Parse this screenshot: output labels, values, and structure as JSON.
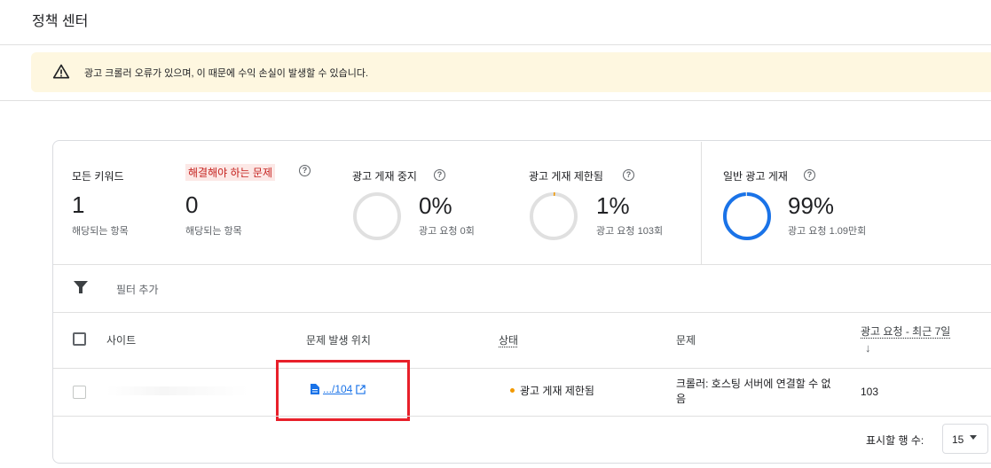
{
  "page": {
    "title": "정책 센터"
  },
  "banner": {
    "message": "광고 크롤러 오류가 있으며, 이 때문에 수익 손실이 발생할 수 있습니다."
  },
  "stats": {
    "all_keywords": {
      "label": "모든 키워드",
      "value": "1",
      "sub": "해당되는 항목"
    },
    "must_fix": {
      "label": "해결해야 하는 문제",
      "help": "?",
      "value": "0",
      "sub": "해당되는 항목"
    },
    "ads_disabled": {
      "label": "광고 게재 중지",
      "help": "?",
      "percent": "0%",
      "sub": "광고 요청 0회",
      "ring_fraction": 0.0
    },
    "ads_restricted": {
      "label": "광고 게재 제한됨",
      "help": "?",
      "percent": "1%",
      "sub": "광고 요청 103회",
      "ring_fraction": 0.01
    },
    "ads_normal": {
      "label": "일반 광고 게재",
      "help": "?",
      "percent": "99%",
      "sub": "광고 요청 1.09만회",
      "ring_fraction": 0.99
    }
  },
  "filter": {
    "label": "필터 추가"
  },
  "table": {
    "headers": {
      "site": "사이트",
      "location": "문제 발생 위치",
      "status": "상태",
      "problem": "문제",
      "requests": "광고 요청 - 최근 7일",
      "sort_arrow": "↓"
    },
    "rows": [
      {
        "site": "",
        "location": ".../104",
        "status": "광고 게재 제한됨",
        "problem": "크롤러: 호스팅 서버에 연결할 수 없음",
        "requests": "103"
      }
    ]
  },
  "pagination": {
    "rows_label": "표시할 행 수:",
    "rows_value": "15"
  },
  "colors": {
    "accent": "#1a73e8",
    "warning_bg": "#fef7e0",
    "highlight_bg": "#fce8e6",
    "status_dot": "#f29900",
    "annotation_box": "#e8202a"
  }
}
